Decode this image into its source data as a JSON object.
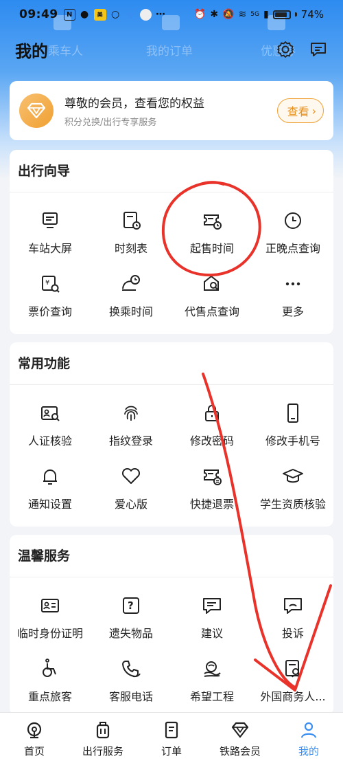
{
  "status_bar": {
    "time": "09:49",
    "battery": "74%",
    "network_5g": "5G"
  },
  "under_nav": {
    "items": [
      "乘车人",
      "我的订单",
      "优惠券"
    ]
  },
  "header": {
    "title": "我的"
  },
  "member": {
    "title": "尊敬的会员，查看您的权益",
    "subtitle": "积分兑换/出行专享服务",
    "view_label": "查看"
  },
  "travel_guide": {
    "title": "出行向导",
    "items": [
      {
        "label": "车站大屏",
        "icon": "screen-icon"
      },
      {
        "label": "时刻表",
        "icon": "timetable-icon"
      },
      {
        "label": "起售时间",
        "icon": "sale-time-icon"
      },
      {
        "label": "正晚点查询",
        "icon": "clock-icon"
      },
      {
        "label": "票价查询",
        "icon": "ticket-price-icon"
      },
      {
        "label": "换乘时间",
        "icon": "transfer-time-icon"
      },
      {
        "label": "代售点查询",
        "icon": "agency-search-icon"
      },
      {
        "label": "更多",
        "icon": "more-icon"
      }
    ]
  },
  "common": {
    "title": "常用功能",
    "items": [
      {
        "label": "人证核验",
        "icon": "id-verify-icon"
      },
      {
        "label": "指纹登录",
        "icon": "fingerprint-icon"
      },
      {
        "label": "修改密码",
        "icon": "lock-icon"
      },
      {
        "label": "修改手机号",
        "icon": "phone-icon"
      },
      {
        "label": "通知设置",
        "icon": "bell-icon"
      },
      {
        "label": "爱心版",
        "icon": "heart-icon"
      },
      {
        "label": "快捷退票",
        "icon": "refund-ticket-icon"
      },
      {
        "label": "学生资质核验",
        "icon": "graduation-cap-icon"
      }
    ]
  },
  "warm": {
    "title": "温馨服务",
    "items": [
      {
        "label": "临时身份证明",
        "icon": "id-card-icon"
      },
      {
        "label": "遗失物品",
        "icon": "lost-item-icon"
      },
      {
        "label": "建议",
        "icon": "suggestion-icon"
      },
      {
        "label": "投诉",
        "icon": "complaint-icon"
      },
      {
        "label": "重点旅客",
        "icon": "wheelchair-icon"
      },
      {
        "label": "客服电话",
        "icon": "service-phone-icon"
      },
      {
        "label": "希望工程",
        "icon": "hope-project-icon"
      },
      {
        "label": "外国商务人...",
        "icon": "foreign-business-icon"
      }
    ]
  },
  "bottom_nav": {
    "items": [
      {
        "label": "首页",
        "icon": "home-icon"
      },
      {
        "label": "出行服务",
        "icon": "luggage-icon"
      },
      {
        "label": "订单",
        "icon": "order-icon"
      },
      {
        "label": "铁路会员",
        "icon": "diamond-icon"
      },
      {
        "label": "我的",
        "icon": "profile-icon"
      }
    ],
    "active": "我的"
  },
  "colors": {
    "accent": "#3a8ef2",
    "member_gold": "#f0a032",
    "annotation_red": "#e8322a"
  }
}
